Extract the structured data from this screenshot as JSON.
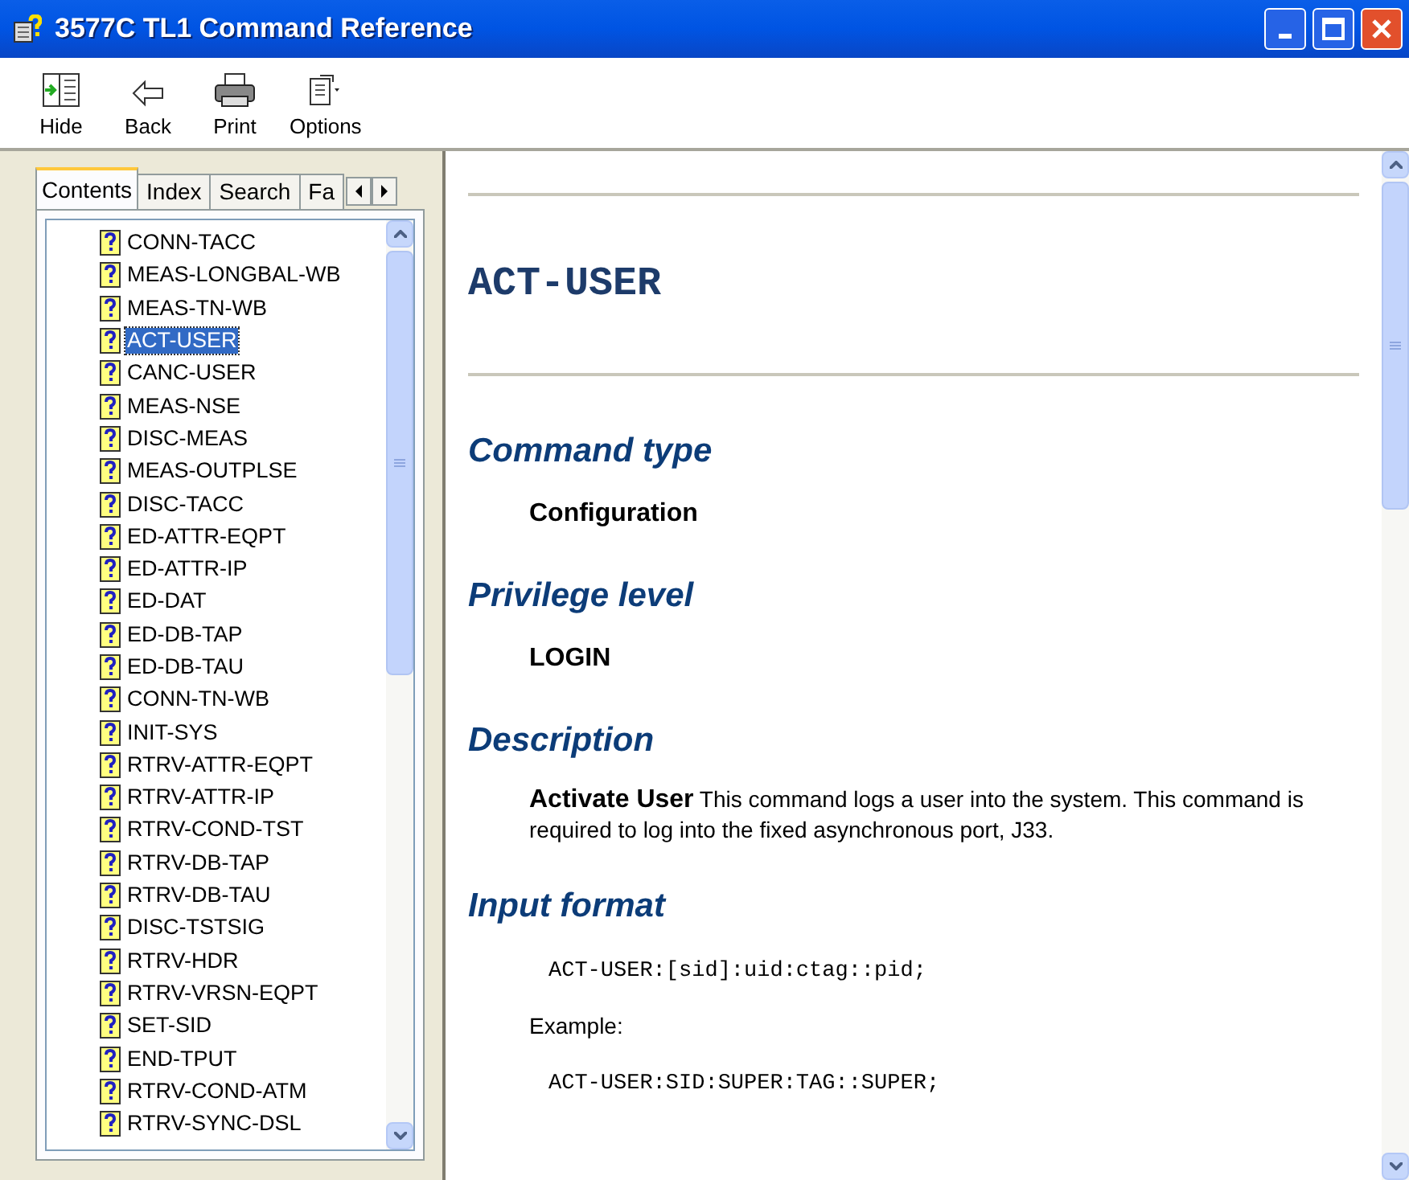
{
  "window": {
    "title": "3577C TL1 Command Reference"
  },
  "toolbar": [
    {
      "kind": "hide",
      "label": "Hide"
    },
    {
      "kind": "back",
      "label": "Back"
    },
    {
      "kind": "print",
      "label": "Print"
    },
    {
      "kind": "options",
      "label": "Options"
    }
  ],
  "tabs": [
    {
      "label": "Contents",
      "selected": true
    },
    {
      "label": "Index",
      "selected": false
    },
    {
      "label": "Search",
      "selected": false
    },
    {
      "label": "Fa",
      "selected": false
    }
  ],
  "tree": {
    "items": [
      {
        "label": "CONN-TACC",
        "selected": false
      },
      {
        "label": "MEAS-LONGBAL-WB",
        "selected": false
      },
      {
        "label": "MEAS-TN-WB",
        "selected": false
      },
      {
        "label": "ACT-USER",
        "selected": true
      },
      {
        "label": "CANC-USER",
        "selected": false
      },
      {
        "label": "MEAS-NSE",
        "selected": false
      },
      {
        "label": "DISC-MEAS",
        "selected": false
      },
      {
        "label": "MEAS-OUTPLSE",
        "selected": false
      },
      {
        "label": "DISC-TACC",
        "selected": false
      },
      {
        "label": "ED-ATTR-EQPT",
        "selected": false
      },
      {
        "label": "ED-ATTR-IP",
        "selected": false
      },
      {
        "label": "ED-DAT",
        "selected": false
      },
      {
        "label": "ED-DB-TAP",
        "selected": false
      },
      {
        "label": "ED-DB-TAU",
        "selected": false
      },
      {
        "label": "CONN-TN-WB",
        "selected": false
      },
      {
        "label": "INIT-SYS",
        "selected": false
      },
      {
        "label": "RTRV-ATTR-EQPT",
        "selected": false
      },
      {
        "label": "RTRV-ATTR-IP",
        "selected": false
      },
      {
        "label": "RTRV-COND-TST",
        "selected": false
      },
      {
        "label": "RTRV-DB-TAP",
        "selected": false
      },
      {
        "label": "RTRV-DB-TAU",
        "selected": false
      },
      {
        "label": "DISC-TSTSIG",
        "selected": false
      },
      {
        "label": "RTRV-HDR",
        "selected": false
      },
      {
        "label": "RTRV-VRSN-EQPT",
        "selected": false
      },
      {
        "label": "SET-SID",
        "selected": false
      },
      {
        "label": "END-TPUT",
        "selected": false
      },
      {
        "label": "RTRV-COND-ATM",
        "selected": false
      },
      {
        "label": "RTRV-SYNC-DSL",
        "selected": false
      }
    ]
  },
  "document": {
    "title": "ACT-USER",
    "sections": [
      {
        "heading": "Command type",
        "blocks": [
          {
            "kind": "strong",
            "text": "Configuration"
          }
        ]
      },
      {
        "heading": "Privilege level",
        "blocks": [
          {
            "kind": "strong",
            "text": "LOGIN"
          }
        ]
      },
      {
        "heading": "Description",
        "blocks": [
          {
            "kind": "para",
            "text": "**Activate User**  This command logs a user into the system. This command is required to log into the fixed asynchronous port, J33."
          }
        ]
      },
      {
        "heading": "Input format",
        "blocks": [
          {
            "kind": "code",
            "text": "ACT-USER:[sid]:uid:ctag::pid;"
          },
          {
            "kind": "para",
            "text": "Example:"
          },
          {
            "kind": "code",
            "text": "ACT-USER:SID:SUPER:TAG::SUPER;"
          }
        ]
      }
    ]
  }
}
